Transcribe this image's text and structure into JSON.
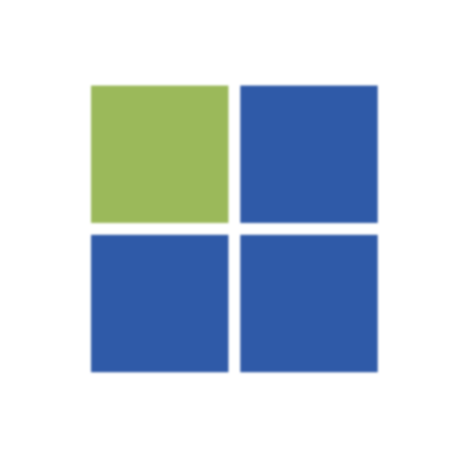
{
  "logo": {
    "icon": "four-square-grid-logo-icon",
    "tiles": [
      {
        "name": "tile-top-left",
        "color": "#9bb95a"
      },
      {
        "name": "tile-top-right",
        "color": "#2f5aa8"
      },
      {
        "name": "tile-bottom-left",
        "color": "#2f5aa8"
      },
      {
        "name": "tile-bottom-right",
        "color": "#2f5aa8"
      }
    ]
  }
}
